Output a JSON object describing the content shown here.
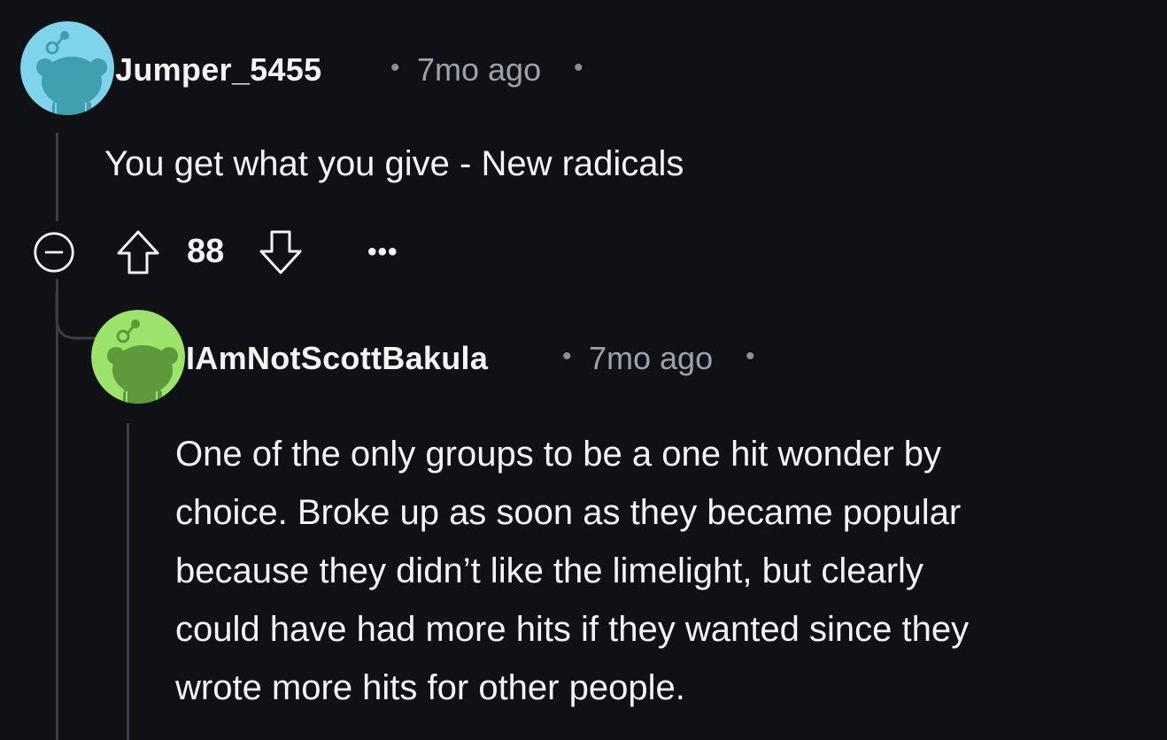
{
  "comments": [
    {
      "username": "Jumper_5455",
      "time": "7mo ago",
      "separator": "•",
      "body": [
        "You get what you give - New radicals"
      ],
      "votes": "88",
      "more": "•••",
      "avatar_color": "#7fd3ea"
    },
    {
      "username": "IAmNotScottBakula",
      "time": "7mo ago",
      "separator": "•",
      "body": [
        "One of the only groups to be a one hit wonder by",
        "choice. Broke up as soon as they became popular",
        "because they didn’t like the limelight, but clearly",
        "could have had more hits if they wanted since they",
        "wrote more hits for other people."
      ],
      "avatar_color": "#9be36a"
    }
  ]
}
